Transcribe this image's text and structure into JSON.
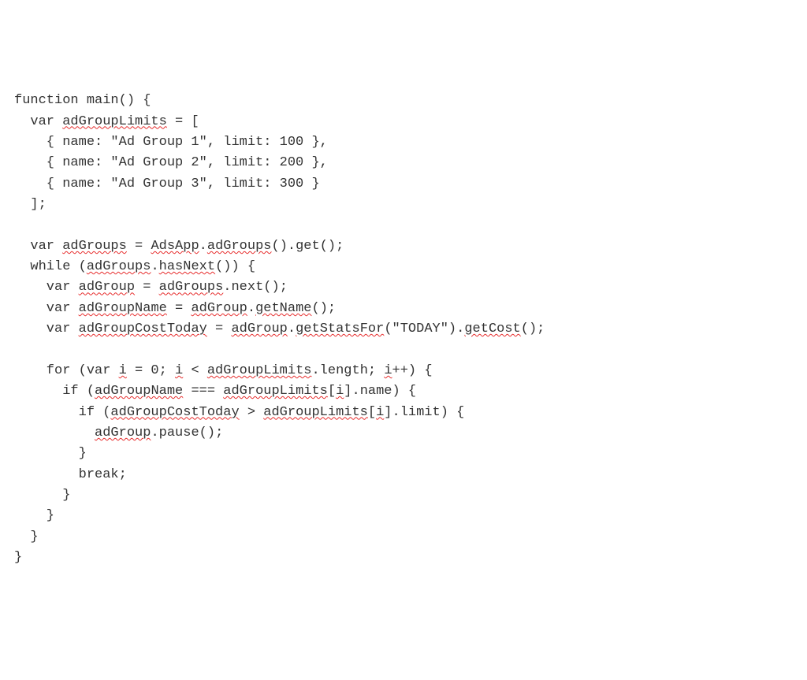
{
  "code": {
    "lines": [
      {
        "pre": "function main() {",
        "sq": "",
        "post": ""
      },
      {
        "pre": "  var ",
        "sq": "adGroupLimits",
        "post": " = ["
      },
      {
        "pre": "    { name: \"Ad Group 1\", limit: 100 },",
        "sq": "",
        "post": ""
      },
      {
        "pre": "    { name: \"Ad Group 2\", limit: 200 },",
        "sq": "",
        "post": ""
      },
      {
        "pre": "    { name: \"Ad Group 3\", limit: 300 }",
        "sq": "",
        "post": ""
      },
      {
        "pre": "  ];",
        "sq": "",
        "post": ""
      },
      {
        "pre": "",
        "sq": "",
        "post": ""
      },
      {
        "pre": "  var ",
        "sq": "adGroups",
        "post": " = ",
        "sq2": "AdsApp",
        "post2": ".",
        "sq3": "adGroups",
        "post3": "().get();"
      },
      {
        "pre": "  while (",
        "sq": "adGroups",
        "post": ".",
        "sq2": "hasNext",
        "post2": "()) {"
      },
      {
        "pre": "    var ",
        "sq": "adGroup",
        "post": " = ",
        "sq2": "adGroups",
        "post2": ".next();"
      },
      {
        "pre": "    var ",
        "sq": "adGroupName",
        "post": " = ",
        "sq2": "adGroup",
        "post2": ".",
        "sq3": "getName",
        "post3": "();"
      },
      {
        "pre": "    var ",
        "sq": "adGroupCostToday",
        "post": " = ",
        "sq2": "adGroup",
        "post2": ".",
        "sq3": "getStatsFor",
        "post3": "(\"TODAY\").",
        "sq4": "getCost",
        "post4": "();"
      },
      {
        "pre": "",
        "sq": "",
        "post": ""
      },
      {
        "pre": "    for (var ",
        "sq": "i",
        "post": " = 0; ",
        "sq2": "i",
        "post2": " < ",
        "sq3": "adGroupLimits",
        "post3": ".length; ",
        "sq4": "i",
        "post4": "++) {"
      },
      {
        "pre": "      if (",
        "sq": "adGroupName",
        "post": " === ",
        "sq2": "adGroupLimits",
        "post2": "[",
        "sq3": "i",
        "post3": "].name) {"
      },
      {
        "pre": "        if (",
        "sq": "adGroupCostToday",
        "post": " > ",
        "sq2": "adGroupLimits",
        "post2": "[",
        "sq3": "i",
        "post3": "].limit) {"
      },
      {
        "pre": "          ",
        "sq": "adGroup",
        "post": ".pause();"
      },
      {
        "pre": "        }",
        "sq": "",
        "post": ""
      },
      {
        "pre": "        break;",
        "sq": "",
        "post": ""
      },
      {
        "pre": "      }",
        "sq": "",
        "post": ""
      },
      {
        "pre": "    }",
        "sq": "",
        "post": ""
      },
      {
        "pre": "  }",
        "sq": "",
        "post": ""
      },
      {
        "pre": "}",
        "sq": "",
        "post": ""
      }
    ]
  }
}
